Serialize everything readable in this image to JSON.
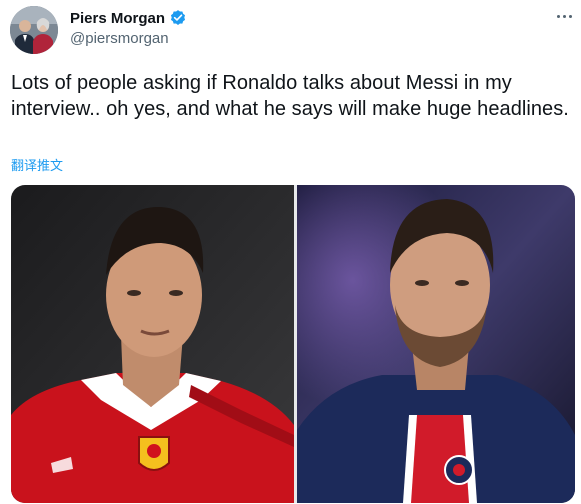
{
  "author": {
    "display_name": "Piers Morgan",
    "handle": "@piersmorgan",
    "verified": true
  },
  "tweet": {
    "text": "Lots of people asking if Ronaldo talks about Messi in my interview.. oh yes, and what he says will make huge headlines.",
    "translate_label": "翻译推文"
  },
  "media": {
    "images": [
      {
        "subject": "Ronaldo",
        "icon": "photo"
      },
      {
        "subject": "Messi",
        "icon": "photo"
      }
    ]
  },
  "colors": {
    "accent": "#1d9bf0",
    "text": "#0f1419",
    "secondary": "#536471",
    "united_red": "#d0121d",
    "psg_navy": "#1c2a5a"
  }
}
